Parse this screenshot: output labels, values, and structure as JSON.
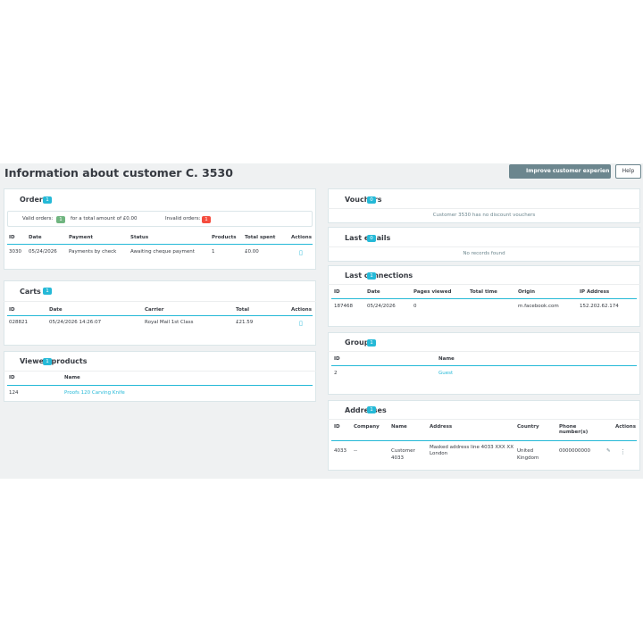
{
  "page": {
    "title": "Information about customer C. 3530",
    "improve_button": "Improve customer experien",
    "help_button": "Help"
  },
  "orders": {
    "title": "Orders",
    "count": "1",
    "valid_label": "Valid orders:",
    "valid_count": "1",
    "total_text": "for a total amount of £0.00",
    "invalid_label": "Invalid orders:",
    "invalid_count": "1",
    "columns": [
      "ID",
      "Date",
      "Payment",
      "Status",
      "Products",
      "Total spent",
      "Actions"
    ],
    "rows": [
      {
        "id": "3030",
        "date": "05/24/2026",
        "payment": "Payments by check",
        "status": "Awaiting cheque payment",
        "products": "1",
        "total": "£0.00"
      }
    ]
  },
  "carts": {
    "title": "Carts",
    "count": "1",
    "columns": [
      "ID",
      "Date",
      "Carrier",
      "Total",
      "Actions"
    ],
    "rows": [
      {
        "id": "028821",
        "date": "05/24/2026 14:26:07",
        "carrier": "Royal Mail 1st Class",
        "total": "£21.59"
      }
    ]
  },
  "viewed": {
    "title": "Viewed products",
    "count": "1",
    "columns": [
      "ID",
      "Name"
    ],
    "rows": [
      {
        "id": "124",
        "name": "Proofs 120 Carving Knife"
      }
    ]
  },
  "vouchers": {
    "title": "Vouchers",
    "count": "0",
    "message": "Customer 3530 has no discount vouchers"
  },
  "emails": {
    "title": "Last emails",
    "count": "0",
    "message": "No records found"
  },
  "connections": {
    "title": "Last connections",
    "count": "1",
    "columns": [
      "ID",
      "Date",
      "Pages viewed",
      "Total time",
      "Origin",
      "IP Address"
    ],
    "rows": [
      {
        "id": "187468",
        "date": "05/24/2026",
        "pages": "0",
        "time": "",
        "origin": "m.facebook.com",
        "ip": "152.202.62.174"
      }
    ]
  },
  "groups": {
    "title": "Groups",
    "count": "1",
    "columns": [
      "ID",
      "Name"
    ],
    "rows": [
      {
        "id": "2",
        "name": "Guest"
      }
    ]
  },
  "addresses": {
    "title": "Addresses",
    "count": "1",
    "columns": [
      "ID",
      "Company",
      "Name",
      "Address",
      "Country",
      "Phone number(s)",
      "Actions"
    ],
    "rows": [
      {
        "id": "4033",
        "company": "--",
        "name": "Customer 4033",
        "address_line1": "Masked address line 4033 XXX XX",
        "address_line2": "London",
        "country": "United Kingdom",
        "phone": "0000000000"
      }
    ],
    "edit_glyph": "✎",
    "more_glyph": "⋮"
  },
  "icons": {
    "view_icon": "▯",
    "accent": "#25b9d7"
  }
}
